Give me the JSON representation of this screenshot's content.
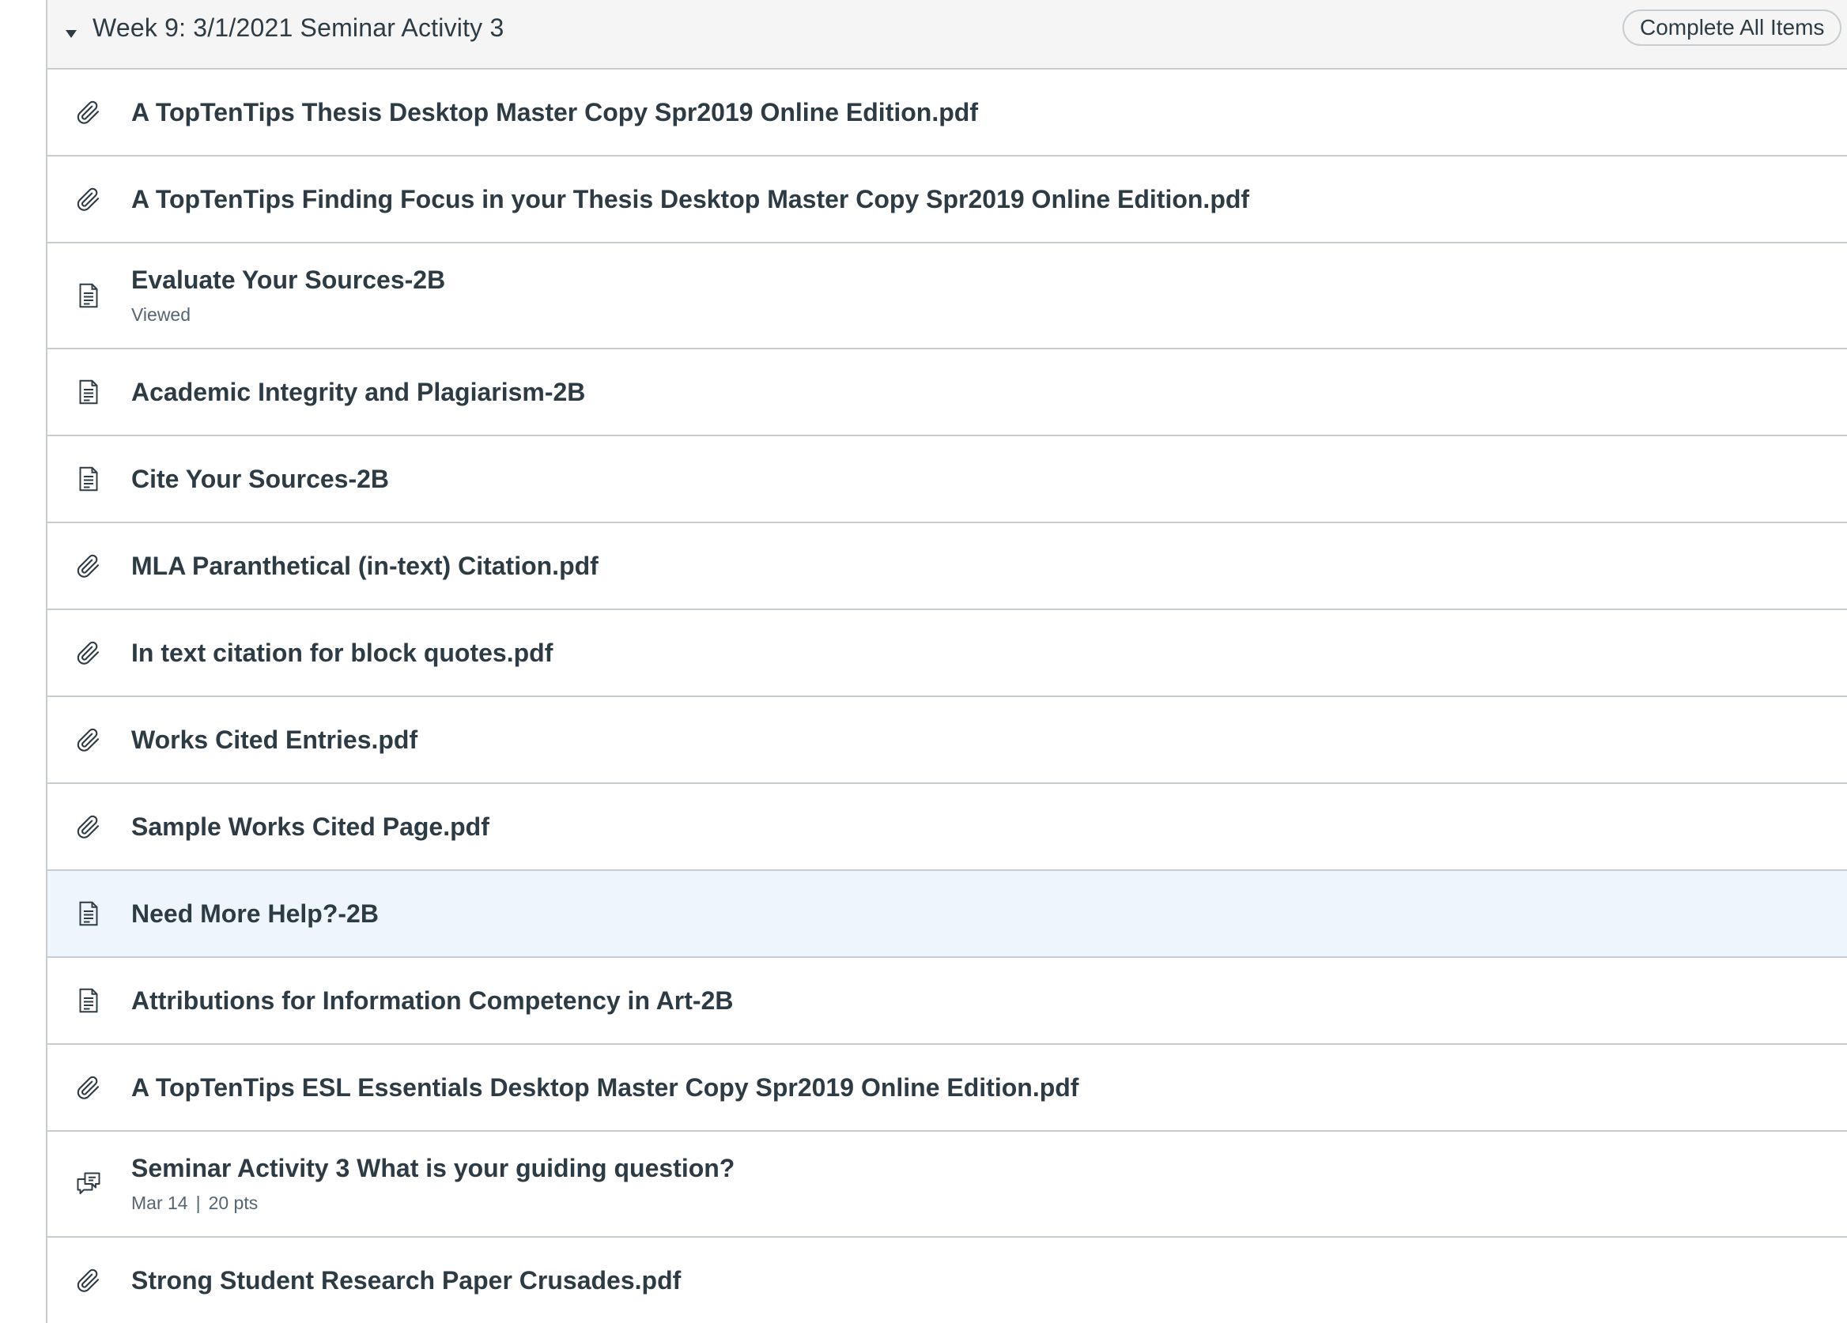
{
  "module": {
    "title": "Week 9: 3/1/2021 Seminar Activity 3",
    "complete_all_label": "Complete All Items"
  },
  "items": [
    {
      "type": "attachment",
      "icon": "paperclip-icon",
      "title": "A TopTenTips Thesis Desktop Master Copy Spr2019 Online Edition.pdf"
    },
    {
      "type": "attachment",
      "icon": "paperclip-icon",
      "title": "A TopTenTips Finding Focus in your Thesis Desktop Master Copy Spr2019 Online Edition.pdf"
    },
    {
      "type": "page",
      "icon": "document-icon",
      "title": "Evaluate Your Sources-2B",
      "meta": "Viewed"
    },
    {
      "type": "page",
      "icon": "document-icon",
      "title": "Academic Integrity and Plagiarism-2B"
    },
    {
      "type": "page",
      "icon": "document-icon",
      "title": "Cite Your Sources-2B"
    },
    {
      "type": "attachment",
      "icon": "paperclip-icon",
      "title": "MLA Paranthetical (in-text) Citation.pdf"
    },
    {
      "type": "attachment",
      "icon": "paperclip-icon",
      "title": "In text citation for block quotes.pdf"
    },
    {
      "type": "attachment",
      "icon": "paperclip-icon",
      "title": "Works Cited Entries.pdf"
    },
    {
      "type": "attachment",
      "icon": "paperclip-icon",
      "title": "Sample Works Cited Page.pdf"
    },
    {
      "type": "page",
      "icon": "document-icon",
      "title": "Need More Help?-2B"
    },
    {
      "type": "page",
      "icon": "document-icon",
      "title": "Attributions for Information Competency in Art-2B"
    },
    {
      "type": "attachment",
      "icon": "paperclip-icon",
      "title": "A TopTenTips ESL Essentials Desktop Master Copy Spr2019 Online Edition.pdf"
    },
    {
      "type": "discussion",
      "icon": "discussion-icon",
      "title": "Seminar Activity 3 What is your guiding question?",
      "due": "Mar 14",
      "separator": "|",
      "points": "20 pts"
    },
    {
      "type": "attachment",
      "icon": "paperclip-icon",
      "title": "Strong Student Research Paper Crusades.pdf"
    }
  ],
  "colors": {
    "text": "#2d3b45",
    "muted": "#556572",
    "border": "#c7cdd1",
    "header_bg": "#f5f5f5",
    "highlight_bg": "#eef5fc"
  }
}
